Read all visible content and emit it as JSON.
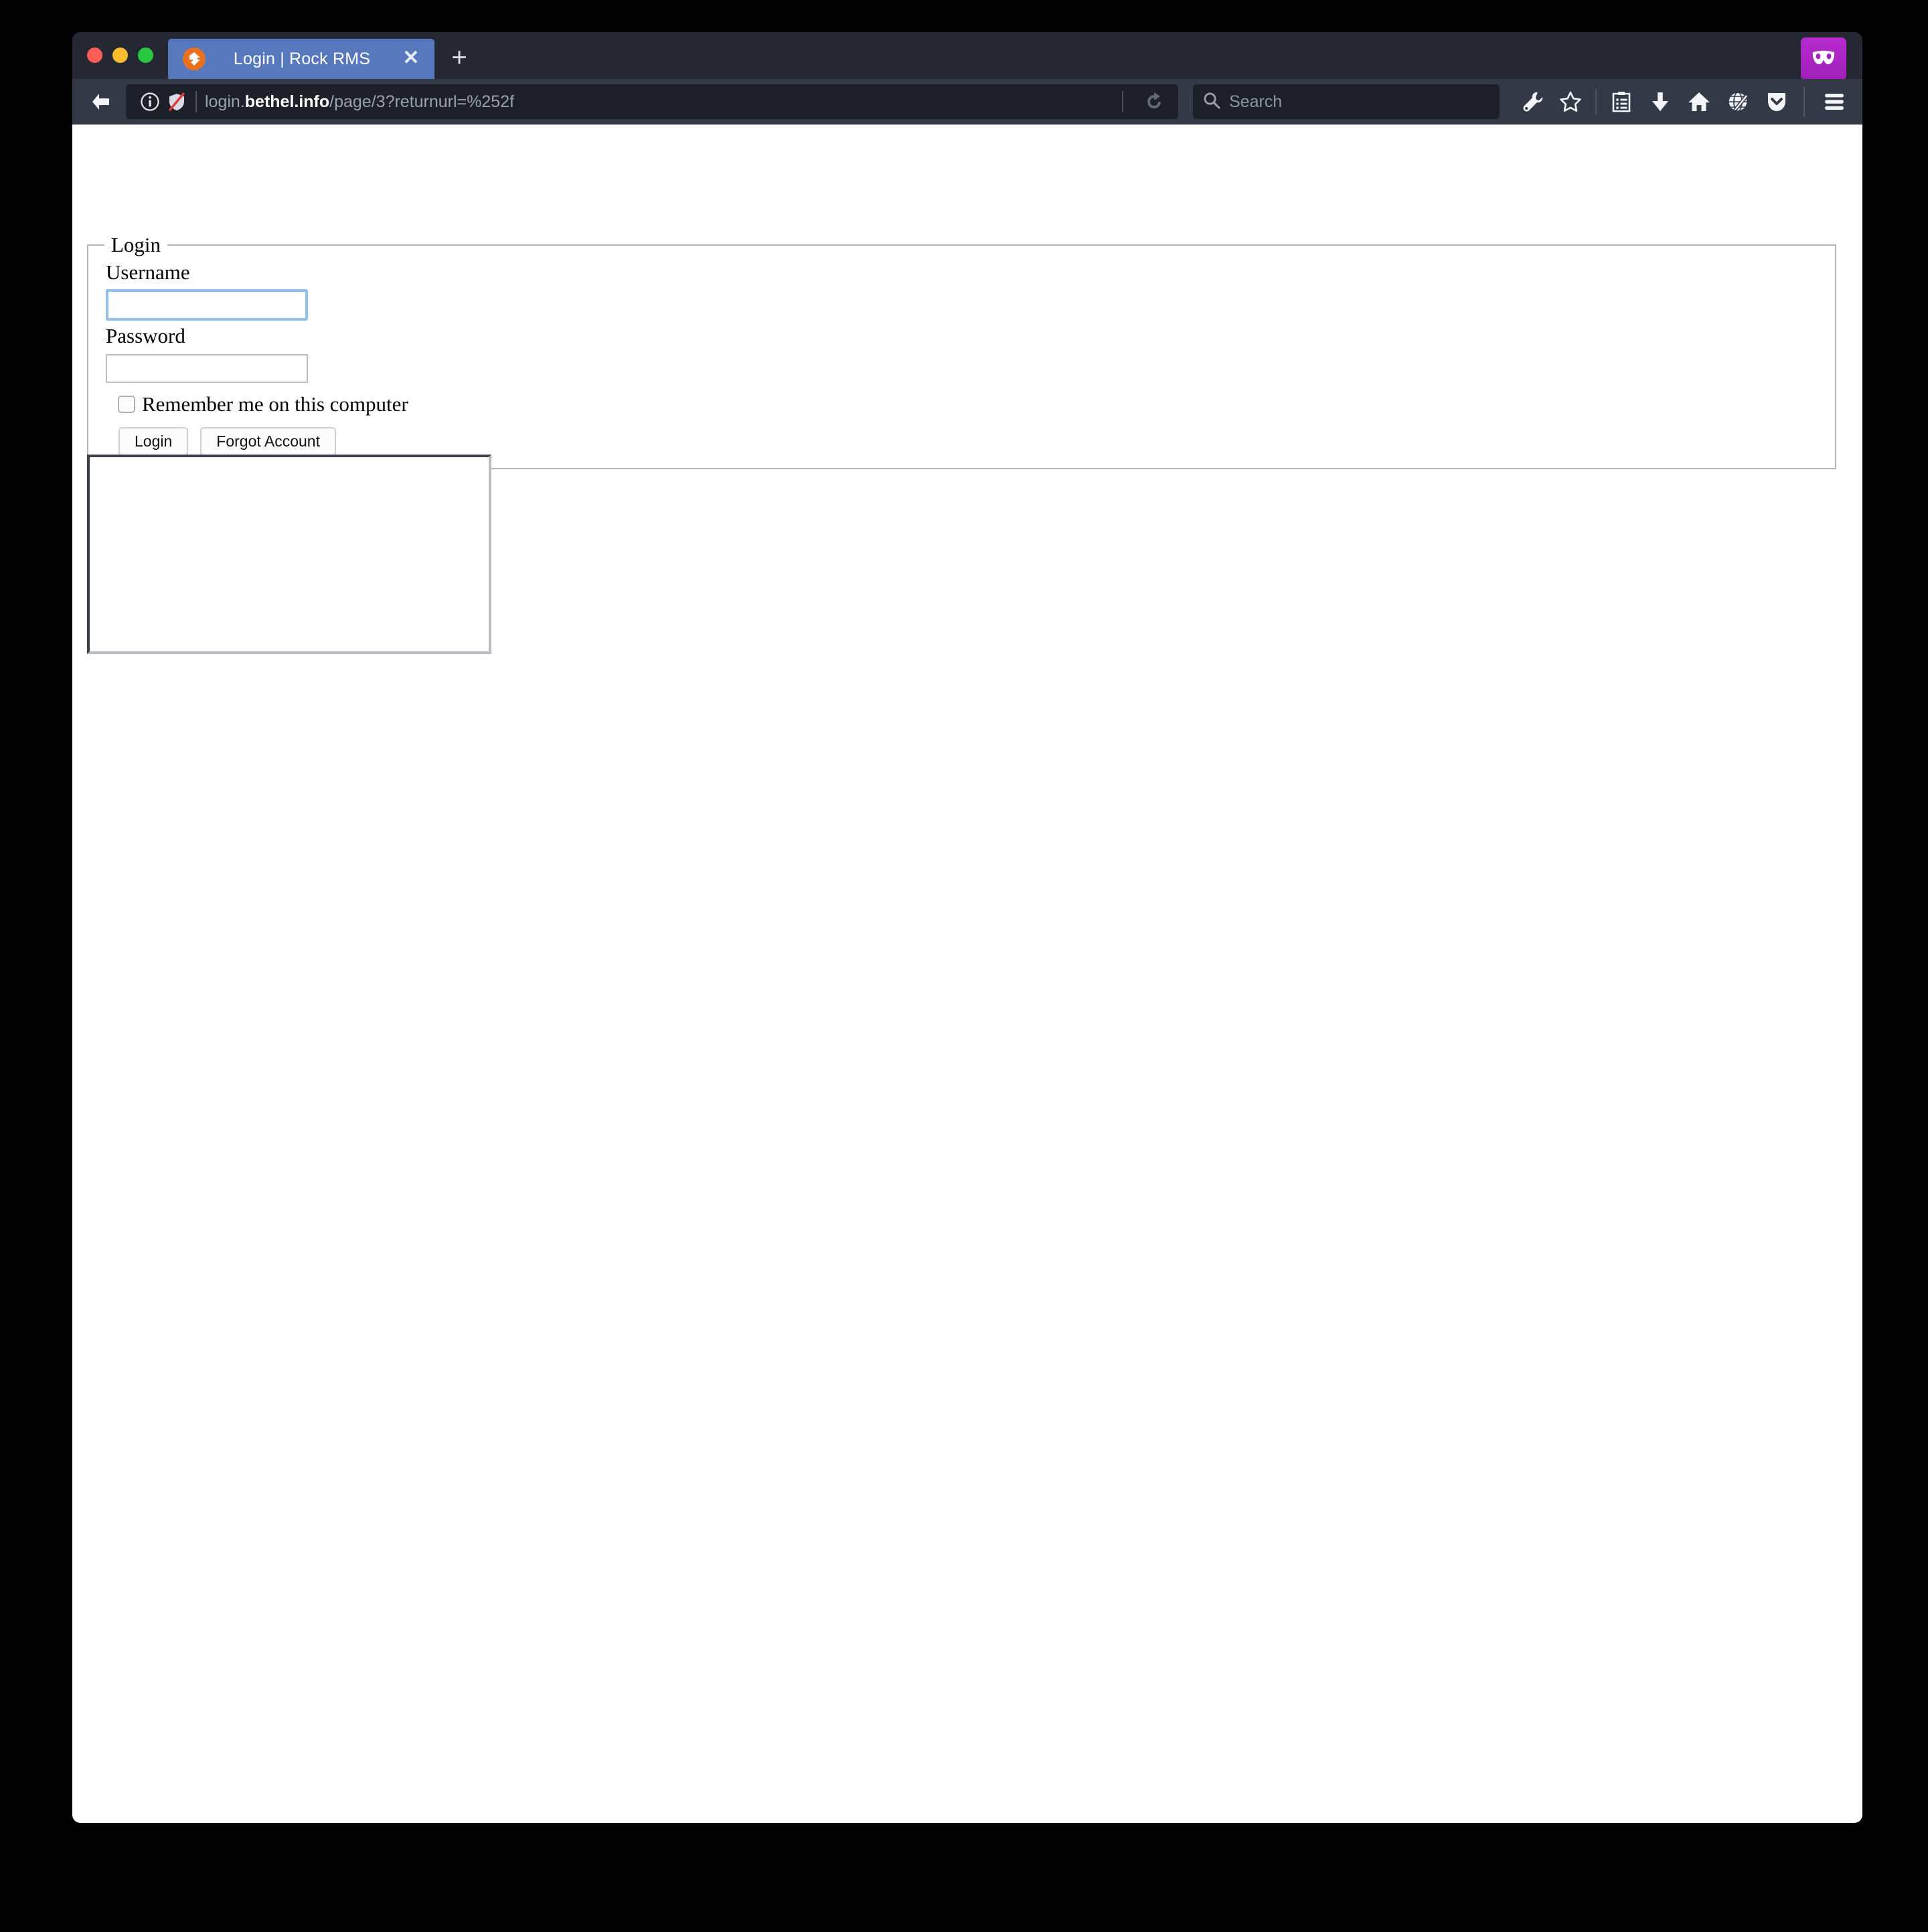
{
  "window": {
    "traffic_lights": [
      {
        "name": "close",
        "color": "#ff5f57"
      },
      {
        "name": "minimize",
        "color": "#ffbd2e"
      },
      {
        "name": "zoom",
        "color": "#28c940"
      }
    ]
  },
  "tabs": [
    {
      "title": "Login | Rock RMS",
      "favicon": "rock-rms-logo-icon",
      "active": true,
      "close_label": "✕"
    }
  ],
  "new_tab": {
    "label": "+"
  },
  "private_browsing": {
    "icon": "mask-icon",
    "accent": "#b72bd0"
  },
  "navigation": {
    "back_icon": "back-arrow-icon",
    "page_info_icon": "info-circle-icon",
    "tracking_protection_icon": "shield-slash-icon",
    "reload_icon": "reload-icon",
    "url": {
      "prefix": "login.",
      "host": "bethel.info",
      "path": "/page/3?returnurl=%252f",
      "full": "login.bethel.info/page/3?returnurl=%252f"
    }
  },
  "search": {
    "placeholder": "Search",
    "icon": "search-icon",
    "value": ""
  },
  "toolbar_icons": [
    {
      "name": "wrench-icon",
      "label": "Developer Tools"
    },
    {
      "name": "star-icon",
      "label": "Bookmark"
    },
    {
      "name": "library-icon",
      "label": "Library"
    },
    {
      "name": "download-icon",
      "label": "Downloads"
    },
    {
      "name": "home-icon",
      "label": "Home"
    },
    {
      "name": "globe-pencil-icon",
      "label": "Web Developer"
    },
    {
      "name": "pocket-icon",
      "label": "Pocket"
    }
  ],
  "app_menu": {
    "icon": "hamburger-menu-icon",
    "label": "Open menu"
  },
  "page": {
    "login_form": {
      "legend": "Login",
      "username": {
        "label": "Username",
        "value": "",
        "placeholder": "",
        "focused": true,
        "focus_color": "#93c0ea"
      },
      "password": {
        "label": "Password",
        "value": "",
        "placeholder": ""
      },
      "remember": {
        "label": "Remember me on this computer",
        "checked": false
      },
      "buttons": {
        "login": "Login",
        "forgot_account": "Forgot Account"
      }
    },
    "empty_panel": {
      "content": "",
      "border_color": "#3a3f48"
    }
  }
}
